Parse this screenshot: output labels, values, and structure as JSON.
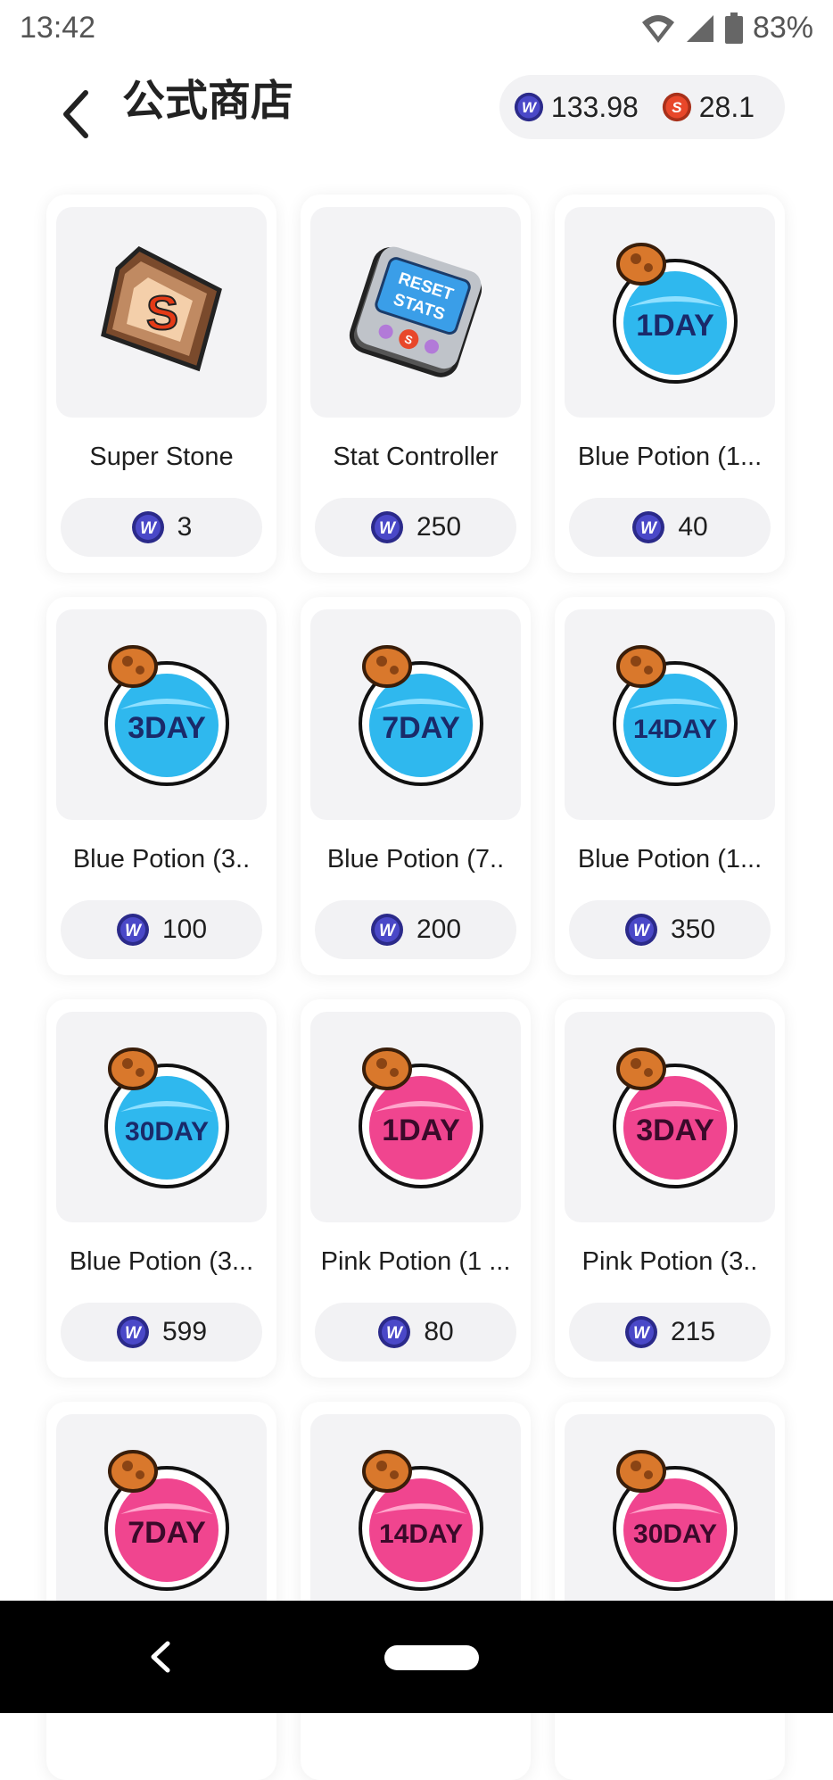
{
  "status": {
    "time": "13:42",
    "battery": "83%"
  },
  "header": {
    "title": "公式商店"
  },
  "balance": {
    "w_value": "133.98",
    "s_value": "28.1"
  },
  "items": [
    {
      "name": "Super Stone",
      "price": "3"
    },
    {
      "name": "Stat Controller",
      "price": "250"
    },
    {
      "name": "Blue Potion (1...",
      "price": "40"
    },
    {
      "name": "Blue Potion (3..",
      "price": "100"
    },
    {
      "name": "Blue Potion (7..",
      "price": "200"
    },
    {
      "name": "Blue Potion (1...",
      "price": "350"
    },
    {
      "name": "Blue Potion (3...",
      "price": "599"
    },
    {
      "name": "Pink Potion (1 ...",
      "price": "80"
    },
    {
      "name": "Pink Potion (3..",
      "price": "215"
    },
    {
      "name": "",
      "price": ""
    },
    {
      "name": "",
      "price": ""
    },
    {
      "name": "",
      "price": ""
    }
  ],
  "images": {
    "stone_letter": "S",
    "stat_label_1": "RESET",
    "stat_label_2": "STATS",
    "stat_coin": "S",
    "potions": [
      "1DAY",
      "3DAY",
      "7DAY",
      "14DAY",
      "30DAY",
      "1DAY",
      "3DAY",
      "7DAY",
      "14DAY",
      "30DAY"
    ]
  },
  "coin_symbols": {
    "w": "W",
    "s": "S"
  },
  "colors": {
    "accent_blue": "#4a48c8",
    "coin_red": "#e8472a",
    "blue_potion": "#2fb8ee",
    "pink_potion": "#f0458f"
  }
}
